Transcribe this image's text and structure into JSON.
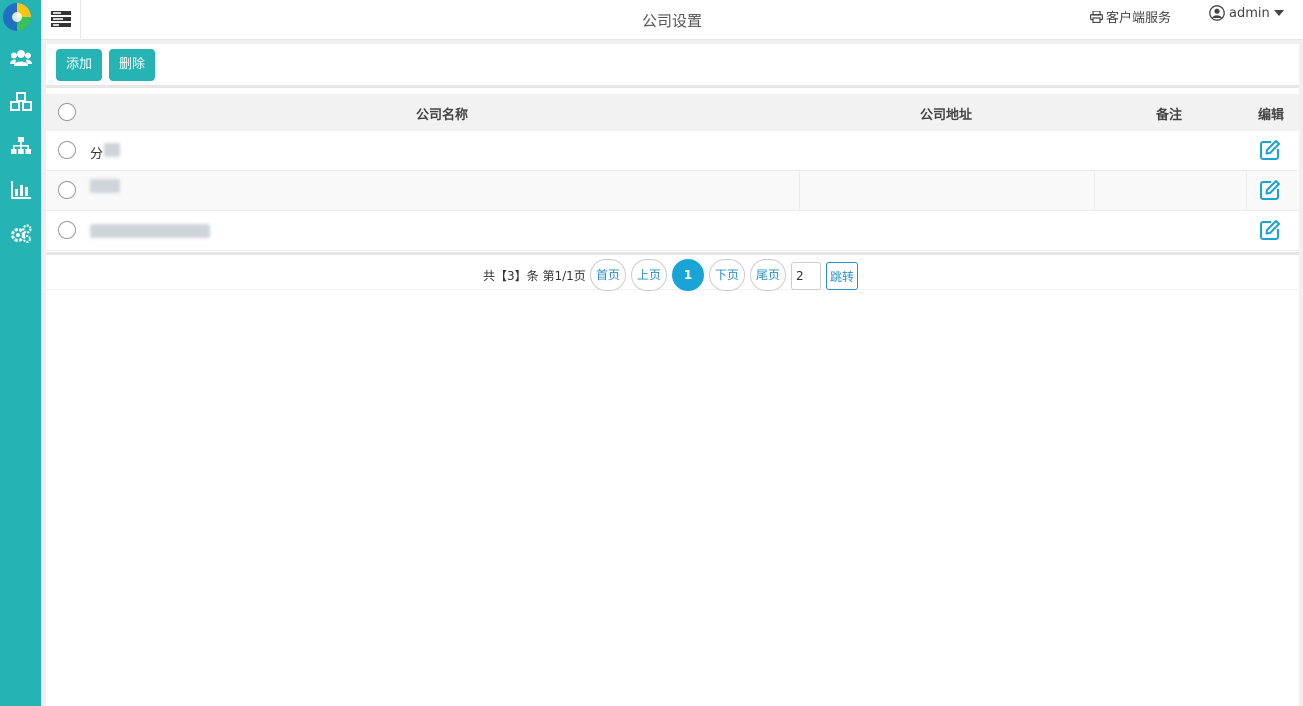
{
  "header": {
    "title": "公司设置",
    "client_service": "客户端服务",
    "user": "admin"
  },
  "sidebar": {
    "items": [
      {
        "icon": "users-icon"
      },
      {
        "icon": "cubes-icon"
      },
      {
        "icon": "sitemap-icon"
      },
      {
        "icon": "bar-chart-icon"
      },
      {
        "icon": "gears-icon"
      }
    ]
  },
  "toolbar": {
    "add_label": "添加",
    "delete_label": "删除"
  },
  "table": {
    "columns": [
      "公司名称",
      "公司地址",
      "备注",
      "编辑"
    ],
    "rows": [
      {
        "name": "分"
      },
      {
        "name": ""
      },
      {
        "name": ""
      }
    ]
  },
  "pagination": {
    "summary": "共【3】条 第1/1页",
    "first": "首页",
    "prev": "上页",
    "current": "1",
    "next": "下页",
    "last": "尾页",
    "jump_value": "2",
    "jump_label": "跳转"
  },
  "colors": {
    "accent": "#26b3b3",
    "page_active": "#1aa4d6",
    "link": "#2a8fc7"
  }
}
